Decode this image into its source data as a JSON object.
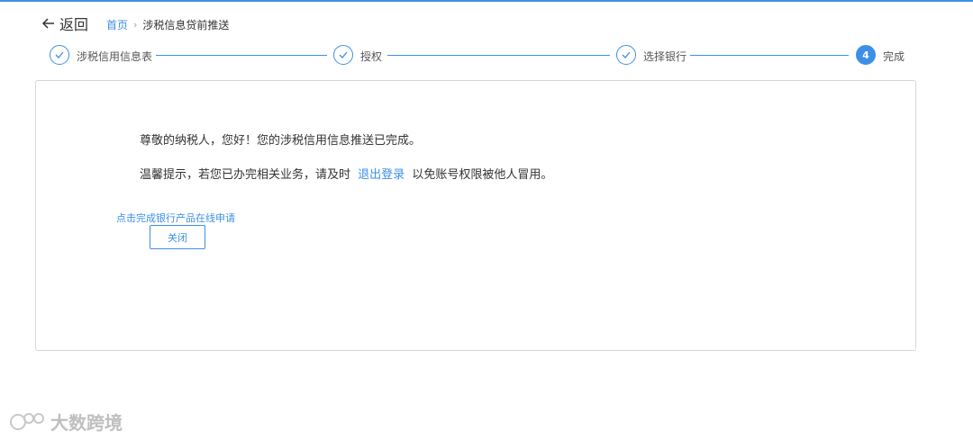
{
  "header": {
    "back_label": "返回",
    "breadcrumb": {
      "home": "首页",
      "separator": "›",
      "current": "涉税信息贷前推送"
    }
  },
  "steps": [
    {
      "label": "涉税信用信息表",
      "status": "done"
    },
    {
      "label": "授权",
      "status": "done"
    },
    {
      "label": "选择银行",
      "status": "done"
    },
    {
      "label": "完成",
      "status": "active",
      "number": "4"
    }
  ],
  "content": {
    "greeting": "尊敬的纳税人，您好！您的涉税信用信息推送已完成。",
    "tip_prefix": "温馨提示，若您已办完相关业务，请及时",
    "logout_link": "退出登录",
    "tip_suffix": "以免账号权限被他人冒用。",
    "apply_link": "点击完成银行产品在线申请",
    "close_button": "关闭"
  },
  "watermark": {
    "text": "大数跨境"
  },
  "colors": {
    "accent": "#3d8fe8",
    "border": "#d6d6d6",
    "text": "#333333"
  }
}
